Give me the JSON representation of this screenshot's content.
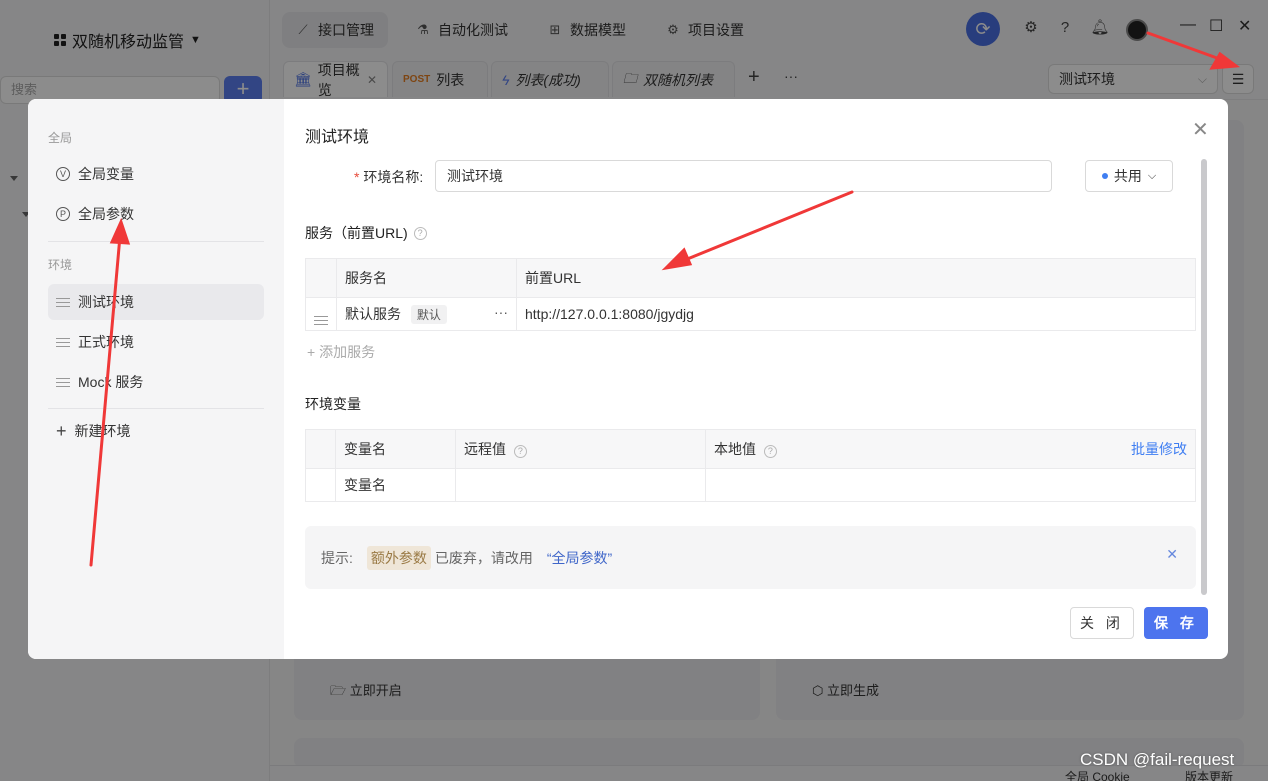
{
  "app": {
    "project_name": "双随机移动监管",
    "search_placeholder": "搜索",
    "add_label": "+"
  },
  "topnav": {
    "tabs": [
      {
        "label": "接口管理",
        "icon": "api-icon"
      },
      {
        "label": "自动化测试",
        "icon": "flask-icon"
      },
      {
        "label": "数据模型",
        "icon": "schema-icon"
      },
      {
        "label": "项目设置",
        "icon": "gear-icon"
      }
    ]
  },
  "doc_tabs": [
    {
      "label": "项目概览",
      "icon": "bank-icon"
    },
    {
      "label": "列表",
      "method": "POST"
    },
    {
      "label": "列表(成功)",
      "icon": "bolt-icon"
    },
    {
      "label": "双随机列表",
      "icon": "folder-icon"
    }
  ],
  "env_select": {
    "value": "测试环境"
  },
  "background_cards": {
    "action_left": "立即开启",
    "action_right": "立即生成"
  },
  "footer": {
    "left": "全局 Cookie",
    "right": "版本更新"
  },
  "modal": {
    "title": "测试环境",
    "sidebar": {
      "section_global": "全局",
      "global_items": [
        {
          "label": "全局变量",
          "icon": "v-circle-icon",
          "glyph": "V"
        },
        {
          "label": "全局参数",
          "icon": "p-circle-icon",
          "glyph": "P"
        }
      ],
      "section_env": "环境",
      "env_items": [
        {
          "label": "测试环境"
        },
        {
          "label": "正式环境"
        },
        {
          "label": "Mock 服务"
        }
      ],
      "new_env_label": "新建环境"
    },
    "env_name_label": "环境名称:",
    "env_name_value": "测试环境",
    "shared_label": "共用",
    "services_title": "服务（前置URL)",
    "services_table": {
      "headers": [
        "服务名",
        "前置URL"
      ],
      "rows": [
        {
          "name": "默认服务",
          "tag": "默认",
          "url": "http://127.0.0.1:8080/jgydjg"
        }
      ]
    },
    "add_service_label": "添加服务",
    "variables_title": "环境变量",
    "variables_table": {
      "headers": [
        "变量名",
        "远程值",
        "本地值"
      ],
      "batch_edit": "批量修改",
      "row_placeholder": "变量名"
    },
    "tip": {
      "prefix": "提示:",
      "tag": "额外参数",
      "middle": "已废弃，请改用",
      "link": "“全局参数”"
    },
    "close_button": "关 闭",
    "save_button": "保 存"
  },
  "watermark": "CSDN @fail-request",
  "annotation_color": "#f03838"
}
